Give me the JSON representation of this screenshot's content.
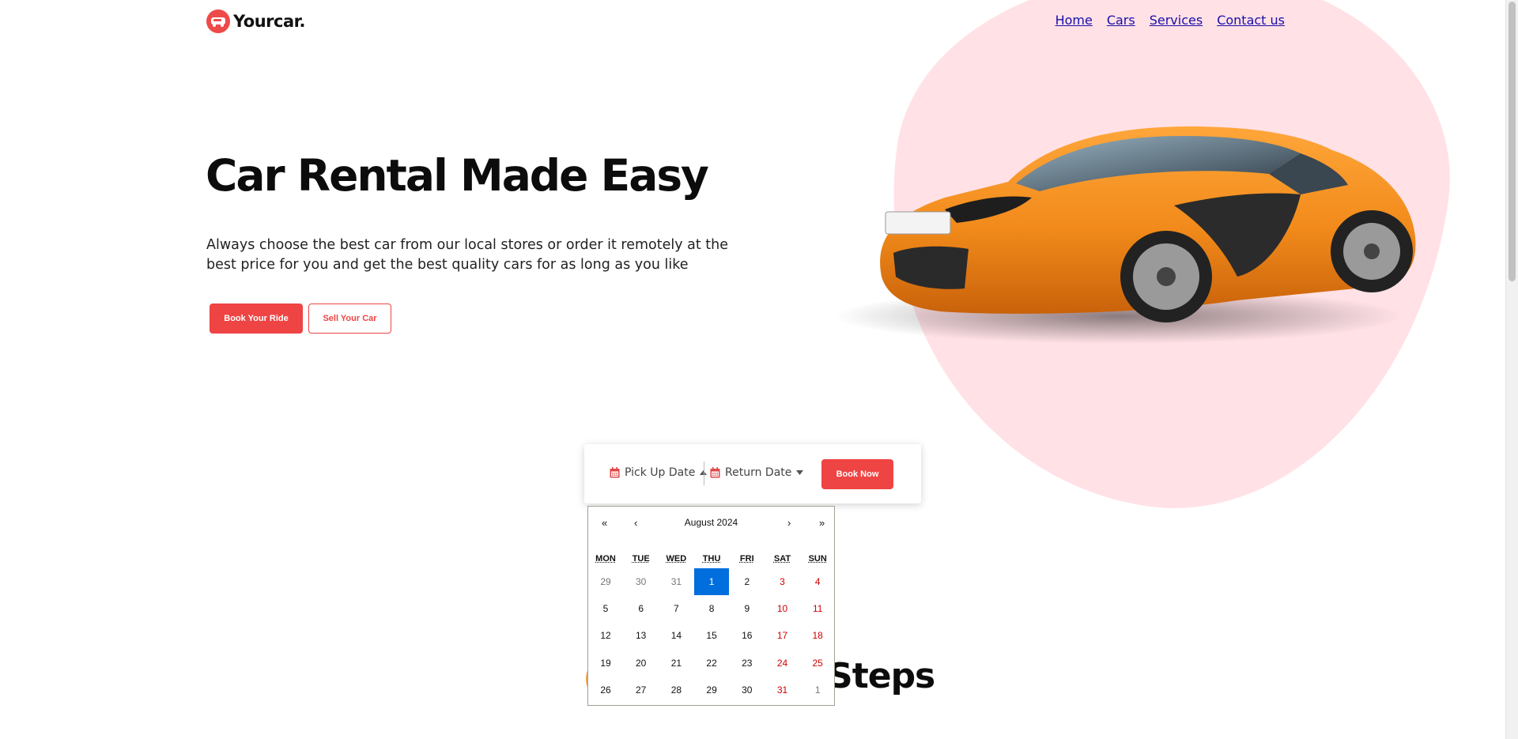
{
  "brand": {
    "name": "Yourcar.",
    "accent": "#ef4444",
    "blob": "#ffe1e6"
  },
  "nav": [
    {
      "label": "Home"
    },
    {
      "label": "Cars"
    },
    {
      "label": "Services"
    },
    {
      "label": "Contact us"
    }
  ],
  "hero": {
    "title": "Car Rental Made Easy",
    "description": "Always choose the best car from our local stores or order it remotely at the best price for you and get the best quality cars for as long as you like",
    "primary_button": "Book Your Ride",
    "secondary_button": "Sell Your Car",
    "image": "car-icon"
  },
  "booking": {
    "pickup_label": "Pick Up Date",
    "return_label": "Return Date",
    "book_button": "Book Now",
    "pickup_icon": "calendar-icon",
    "return_icon": "calendar-icon"
  },
  "calendar": {
    "month_label": "August 2024",
    "prev_year": "«",
    "prev_month": "‹",
    "next_month": "›",
    "next_year": "»",
    "weekdays": [
      "MON",
      "TUE",
      "WED",
      "THU",
      "FRI",
      "SAT",
      "SUN"
    ],
    "weeks": [
      [
        "29",
        "30",
        "31",
        "1",
        "2",
        "3",
        "4"
      ],
      [
        "5",
        "6",
        "7",
        "8",
        "9",
        "10",
        "11"
      ],
      [
        "12",
        "13",
        "14",
        "15",
        "16",
        "17",
        "18"
      ],
      [
        "19",
        "20",
        "21",
        "22",
        "23",
        "24",
        "25"
      ],
      [
        "26",
        "27",
        "28",
        "29",
        "30",
        "31",
        "1"
      ]
    ],
    "selected_day": "1"
  },
  "section_heading_partial": "Steps"
}
